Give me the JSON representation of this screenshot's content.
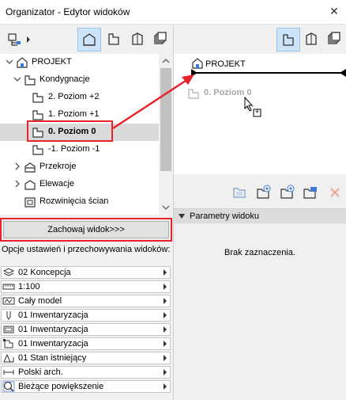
{
  "window": {
    "title": "Organizator - Edytor widoków",
    "close_glyph": "✕"
  },
  "tree": {
    "items": [
      {
        "label": "PROJEKT",
        "icon": "project-house-icon"
      },
      {
        "label": "Kondygnacje",
        "icon": "storey-icon"
      },
      {
        "label": "2. Poziom +2",
        "icon": "floor-icon"
      },
      {
        "label": "1. Poziom +1",
        "icon": "floor-icon"
      },
      {
        "label": "0. Poziom 0",
        "icon": "floor-icon"
      },
      {
        "label": "-1. Poziom -1",
        "icon": "floor-icon"
      },
      {
        "label": "Przekroje",
        "icon": "section-icon"
      },
      {
        "label": "Elewacje",
        "icon": "elevation-icon"
      },
      {
        "label": "Rozwinięcia ścian",
        "icon": "interior-elevation-icon"
      }
    ]
  },
  "save_button": {
    "label": "Zachowaj widok>>>"
  },
  "options": {
    "label": "Opcje ustawień i przechowywania widoków:",
    "rows": [
      {
        "value": "02 Koncepcja",
        "icon": "layers-icon"
      },
      {
        "value": "1:100",
        "icon": "scale-ruler-icon"
      },
      {
        "value": "Cały model",
        "icon": "structure-display-icon"
      },
      {
        "value": "01 Inwentaryzacja",
        "icon": "pen-set-icon"
      },
      {
        "value": "01 Inwentaryzacja",
        "icon": "graphic-override-icon"
      },
      {
        "value": "01 Inwentaryzacja",
        "icon": "model-view-icon"
      },
      {
        "value": "01 Stan istniejący",
        "icon": "renovation-filter-icon"
      },
      {
        "value": "Polski arch.",
        "icon": "dimension-icon"
      },
      {
        "value": "Bieżące powiększenie",
        "icon": "zoom-icon"
      }
    ]
  },
  "layout": {
    "project_label": "PROJEKT",
    "dragged_item_label": "0. Poziom 0",
    "drop_cursor_plus": "+"
  },
  "properties": {
    "header": "Parametry widoku",
    "empty_message": "Brak zaznaczenia."
  },
  "colors": {
    "highlight_red": "#e8232c",
    "selected_blue": "#cde3f7",
    "icon_blue": "#3a7bd5"
  }
}
